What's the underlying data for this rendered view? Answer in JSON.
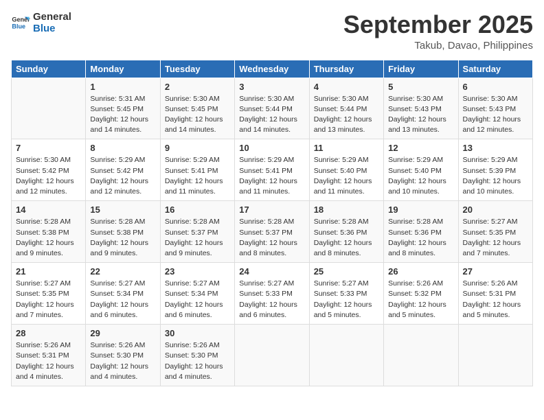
{
  "logo": {
    "line1": "General",
    "line2": "Blue"
  },
  "title": "September 2025",
  "location": "Takub, Davao, Philippines",
  "days_of_week": [
    "Sunday",
    "Monday",
    "Tuesday",
    "Wednesday",
    "Thursday",
    "Friday",
    "Saturday"
  ],
  "weeks": [
    [
      {
        "day": "",
        "sunrise": "",
        "sunset": "",
        "daylight": ""
      },
      {
        "day": "1",
        "sunrise": "Sunrise: 5:31 AM",
        "sunset": "Sunset: 5:45 PM",
        "daylight": "Daylight: 12 hours and 14 minutes."
      },
      {
        "day": "2",
        "sunrise": "Sunrise: 5:30 AM",
        "sunset": "Sunset: 5:45 PM",
        "daylight": "Daylight: 12 hours and 14 minutes."
      },
      {
        "day": "3",
        "sunrise": "Sunrise: 5:30 AM",
        "sunset": "Sunset: 5:44 PM",
        "daylight": "Daylight: 12 hours and 14 minutes."
      },
      {
        "day": "4",
        "sunrise": "Sunrise: 5:30 AM",
        "sunset": "Sunset: 5:44 PM",
        "daylight": "Daylight: 12 hours and 13 minutes."
      },
      {
        "day": "5",
        "sunrise": "Sunrise: 5:30 AM",
        "sunset": "Sunset: 5:43 PM",
        "daylight": "Daylight: 12 hours and 13 minutes."
      },
      {
        "day": "6",
        "sunrise": "Sunrise: 5:30 AM",
        "sunset": "Sunset: 5:43 PM",
        "daylight": "Daylight: 12 hours and 12 minutes."
      }
    ],
    [
      {
        "day": "7",
        "sunrise": "Sunrise: 5:30 AM",
        "sunset": "Sunset: 5:42 PM",
        "daylight": "Daylight: 12 hours and 12 minutes."
      },
      {
        "day": "8",
        "sunrise": "Sunrise: 5:29 AM",
        "sunset": "Sunset: 5:42 PM",
        "daylight": "Daylight: 12 hours and 12 minutes."
      },
      {
        "day": "9",
        "sunrise": "Sunrise: 5:29 AM",
        "sunset": "Sunset: 5:41 PM",
        "daylight": "Daylight: 12 hours and 11 minutes."
      },
      {
        "day": "10",
        "sunrise": "Sunrise: 5:29 AM",
        "sunset": "Sunset: 5:41 PM",
        "daylight": "Daylight: 12 hours and 11 minutes."
      },
      {
        "day": "11",
        "sunrise": "Sunrise: 5:29 AM",
        "sunset": "Sunset: 5:40 PM",
        "daylight": "Daylight: 12 hours and 11 minutes."
      },
      {
        "day": "12",
        "sunrise": "Sunrise: 5:29 AM",
        "sunset": "Sunset: 5:40 PM",
        "daylight": "Daylight: 12 hours and 10 minutes."
      },
      {
        "day": "13",
        "sunrise": "Sunrise: 5:29 AM",
        "sunset": "Sunset: 5:39 PM",
        "daylight": "Daylight: 12 hours and 10 minutes."
      }
    ],
    [
      {
        "day": "14",
        "sunrise": "Sunrise: 5:28 AM",
        "sunset": "Sunset: 5:38 PM",
        "daylight": "Daylight: 12 hours and 9 minutes."
      },
      {
        "day": "15",
        "sunrise": "Sunrise: 5:28 AM",
        "sunset": "Sunset: 5:38 PM",
        "daylight": "Daylight: 12 hours and 9 minutes."
      },
      {
        "day": "16",
        "sunrise": "Sunrise: 5:28 AM",
        "sunset": "Sunset: 5:37 PM",
        "daylight": "Daylight: 12 hours and 9 minutes."
      },
      {
        "day": "17",
        "sunrise": "Sunrise: 5:28 AM",
        "sunset": "Sunset: 5:37 PM",
        "daylight": "Daylight: 12 hours and 8 minutes."
      },
      {
        "day": "18",
        "sunrise": "Sunrise: 5:28 AM",
        "sunset": "Sunset: 5:36 PM",
        "daylight": "Daylight: 12 hours and 8 minutes."
      },
      {
        "day": "19",
        "sunrise": "Sunrise: 5:28 AM",
        "sunset": "Sunset: 5:36 PM",
        "daylight": "Daylight: 12 hours and 8 minutes."
      },
      {
        "day": "20",
        "sunrise": "Sunrise: 5:27 AM",
        "sunset": "Sunset: 5:35 PM",
        "daylight": "Daylight: 12 hours and 7 minutes."
      }
    ],
    [
      {
        "day": "21",
        "sunrise": "Sunrise: 5:27 AM",
        "sunset": "Sunset: 5:35 PM",
        "daylight": "Daylight: 12 hours and 7 minutes."
      },
      {
        "day": "22",
        "sunrise": "Sunrise: 5:27 AM",
        "sunset": "Sunset: 5:34 PM",
        "daylight": "Daylight: 12 hours and 6 minutes."
      },
      {
        "day": "23",
        "sunrise": "Sunrise: 5:27 AM",
        "sunset": "Sunset: 5:34 PM",
        "daylight": "Daylight: 12 hours and 6 minutes."
      },
      {
        "day": "24",
        "sunrise": "Sunrise: 5:27 AM",
        "sunset": "Sunset: 5:33 PM",
        "daylight": "Daylight: 12 hours and 6 minutes."
      },
      {
        "day": "25",
        "sunrise": "Sunrise: 5:27 AM",
        "sunset": "Sunset: 5:33 PM",
        "daylight": "Daylight: 12 hours and 5 minutes."
      },
      {
        "day": "26",
        "sunrise": "Sunrise: 5:26 AM",
        "sunset": "Sunset: 5:32 PM",
        "daylight": "Daylight: 12 hours and 5 minutes."
      },
      {
        "day": "27",
        "sunrise": "Sunrise: 5:26 AM",
        "sunset": "Sunset: 5:31 PM",
        "daylight": "Daylight: 12 hours and 5 minutes."
      }
    ],
    [
      {
        "day": "28",
        "sunrise": "Sunrise: 5:26 AM",
        "sunset": "Sunset: 5:31 PM",
        "daylight": "Daylight: 12 hours and 4 minutes."
      },
      {
        "day": "29",
        "sunrise": "Sunrise: 5:26 AM",
        "sunset": "Sunset: 5:30 PM",
        "daylight": "Daylight: 12 hours and 4 minutes."
      },
      {
        "day": "30",
        "sunrise": "Sunrise: 5:26 AM",
        "sunset": "Sunset: 5:30 PM",
        "daylight": "Daylight: 12 hours and 4 minutes."
      },
      {
        "day": "",
        "sunrise": "",
        "sunset": "",
        "daylight": ""
      },
      {
        "day": "",
        "sunrise": "",
        "sunset": "",
        "daylight": ""
      },
      {
        "day": "",
        "sunrise": "",
        "sunset": "",
        "daylight": ""
      },
      {
        "day": "",
        "sunrise": "",
        "sunset": "",
        "daylight": ""
      }
    ]
  ]
}
